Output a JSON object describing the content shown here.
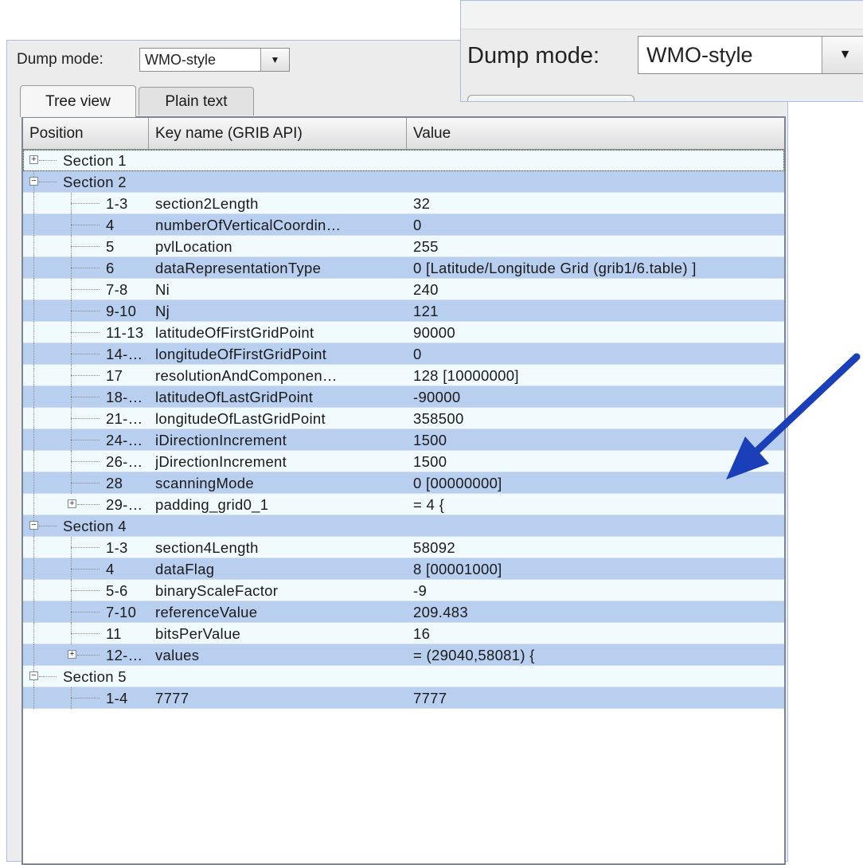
{
  "dump_mode": {
    "label": "Dump mode:",
    "value": "WMO-style",
    "arrow_glyph": "▼"
  },
  "zoom_inset": {
    "label": "Dump mode:",
    "value": "WMO-style",
    "arrow_glyph": "▼"
  },
  "tabs": [
    {
      "label": "Tree view",
      "active": true
    },
    {
      "label": "Plain text",
      "active": false
    }
  ],
  "columns": {
    "position": "Position",
    "key": "Key name (GRIB API)",
    "value": "Value"
  },
  "rows": [
    {
      "level": 0,
      "expander": "plus",
      "pos": "Section 1",
      "key": "",
      "value": ""
    },
    {
      "level": 0,
      "expander": "minus",
      "pos": "Section 2",
      "key": "",
      "value": ""
    },
    {
      "level": 1,
      "expander": "",
      "pos": "1-3",
      "key": "section2Length",
      "value": "32"
    },
    {
      "level": 1,
      "expander": "",
      "pos": "4",
      "key": "numberOfVerticalCoordin…",
      "value": "0"
    },
    {
      "level": 1,
      "expander": "",
      "pos": "5",
      "key": "pvlLocation",
      "value": "255"
    },
    {
      "level": 1,
      "expander": "",
      "pos": "6",
      "key": "dataRepresentationType",
      "value": "0 [Latitude/Longitude Grid (grib1/6.table) ]"
    },
    {
      "level": 1,
      "expander": "",
      "pos": "7-8",
      "key": "Ni",
      "value": "240"
    },
    {
      "level": 1,
      "expander": "",
      "pos": "9-10",
      "key": "Nj",
      "value": "121"
    },
    {
      "level": 1,
      "expander": "",
      "pos": "11-13",
      "key": "latitudeOfFirstGridPoint",
      "value": "90000"
    },
    {
      "level": 1,
      "expander": "",
      "pos": "14-…",
      "key": "longitudeOfFirstGridPoint",
      "value": "0"
    },
    {
      "level": 1,
      "expander": "",
      "pos": "17",
      "key": "resolutionAndComponen…",
      "value": "128 [10000000]"
    },
    {
      "level": 1,
      "expander": "",
      "pos": "18-…",
      "key": "latitudeOfLastGridPoint",
      "value": "-90000"
    },
    {
      "level": 1,
      "expander": "",
      "pos": "21-…",
      "key": "longitudeOfLastGridPoint",
      "value": "358500"
    },
    {
      "level": 1,
      "expander": "",
      "pos": "24-…",
      "key": "iDirectionIncrement",
      "value": "1500"
    },
    {
      "level": 1,
      "expander": "",
      "pos": "26-…",
      "key": "jDirectionIncrement",
      "value": "1500"
    },
    {
      "level": 1,
      "expander": "",
      "pos": "28",
      "key": "scanningMode",
      "value": "0 [00000000]"
    },
    {
      "level": 1,
      "expander": "plus",
      "pos": "29-…",
      "key": "padding_grid0_1",
      "value": "= 4 {"
    },
    {
      "level": 0,
      "expander": "minus",
      "pos": "Section 4",
      "key": "",
      "value": ""
    },
    {
      "level": 1,
      "expander": "",
      "pos": "1-3",
      "key": "section4Length",
      "value": "58092"
    },
    {
      "level": 1,
      "expander": "",
      "pos": "4",
      "key": "dataFlag",
      "value": "8 [00001000]"
    },
    {
      "level": 1,
      "expander": "",
      "pos": "5-6",
      "key": "binaryScaleFactor",
      "value": "-9"
    },
    {
      "level": 1,
      "expander": "",
      "pos": "7-10",
      "key": "referenceValue",
      "value": "209.483"
    },
    {
      "level": 1,
      "expander": "",
      "pos": "11",
      "key": "bitsPerValue",
      "value": "16"
    },
    {
      "level": 1,
      "expander": "plus",
      "pos": "12-…",
      "key": "values",
      "value": "= (29040,58081) {"
    },
    {
      "level": 0,
      "expander": "minus",
      "pos": "Section 5",
      "key": "",
      "value": ""
    },
    {
      "level": 1,
      "expander": "",
      "pos": "1-4",
      "key": "7777",
      "value": "7777"
    }
  ],
  "colors": {
    "row_light": "#f1fbfd",
    "row_blue": "#b9cfef",
    "panel_border": "#a9bde2",
    "annotation_arrow": "#1a3fb8"
  },
  "icons": {
    "expand": "plus-box-icon",
    "collapse": "minus-box-icon",
    "annotation": "arrow-icon"
  }
}
